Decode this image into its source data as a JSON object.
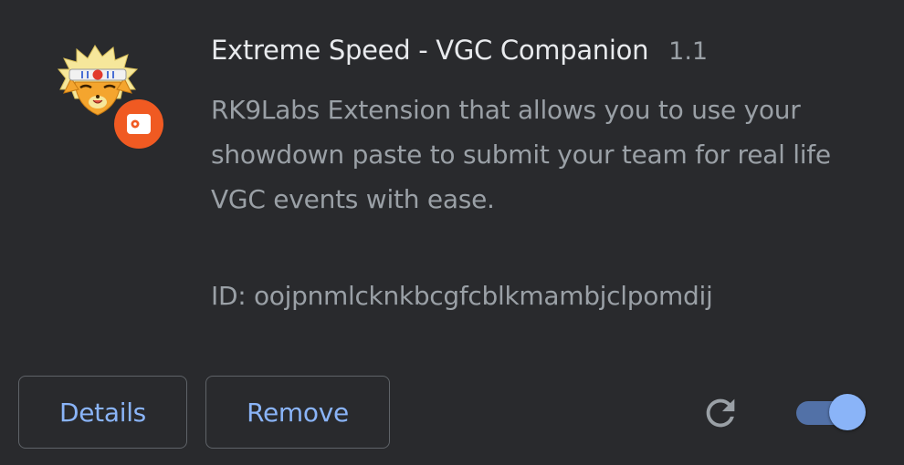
{
  "extension": {
    "name": "Extreme Speed - VGC Companion",
    "version": "1.1",
    "description": "RK9Labs Extension that allows you to use your showdown paste to submit your team for real life VGC events with ease.",
    "id_text": "ID: oojpnmlcknkbcgfcblkmambjclpomdij",
    "icon": "arcanine-headband-logo",
    "badge_icon": "unpacked-extension-badge-icon",
    "badge_color": "#f05a22",
    "enabled": true
  },
  "actions": {
    "details_label": "Details",
    "remove_label": "Remove",
    "reload_icon": "reload-icon"
  },
  "colors": {
    "background": "#292a2d",
    "title": "#e8eaed",
    "secondary_text": "#9aa0a6",
    "accent": "#8ab4f8",
    "border": "#5f6368"
  }
}
